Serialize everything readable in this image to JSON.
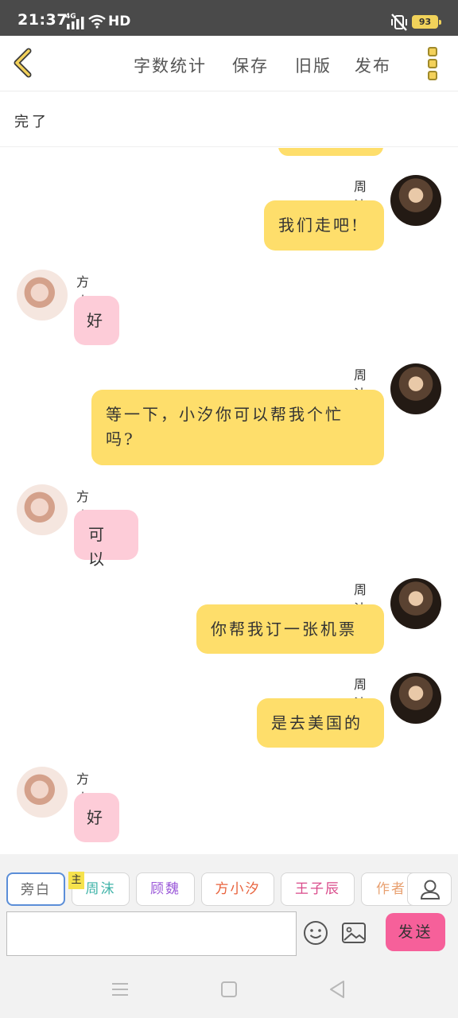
{
  "status_bar": {
    "time": "21:37",
    "network": "4G",
    "hd": "HD",
    "battery": "93",
    "icons": [
      "signal-icon",
      "wifi-icon",
      "vibrate-off-icon",
      "battery-icon"
    ]
  },
  "toolbar": {
    "back_icon": "chevron-left-icon",
    "word_count": "字数统计",
    "save": "保存",
    "old_version": "旧版",
    "publish": "发布",
    "menu_icon": "menu-dots-icon"
  },
  "chapter_title": "完了",
  "messages": [
    {
      "side": "right",
      "sender": "周沫",
      "text": "我们走吧!"
    },
    {
      "side": "left",
      "sender": "方小汐",
      "text": "好"
    },
    {
      "side": "right",
      "sender": "周沫",
      "text": "等一下，小汐你可以帮我个忙吗?"
    },
    {
      "side": "left",
      "sender": "方小汐",
      "text": "可以"
    },
    {
      "side": "right",
      "sender": "周沫",
      "text": "你帮我订一张机票"
    },
    {
      "side": "right",
      "sender": "周沫",
      "text": "是去美国的"
    },
    {
      "side": "left",
      "sender": "方小汐",
      "text": "好"
    }
  ],
  "roles": {
    "main_tag": "主",
    "items": [
      {
        "label": "旁白",
        "color": "#666666"
      },
      {
        "label": "周沫",
        "color": "#3fb3a8"
      },
      {
        "label": "顾魏",
        "color": "#9b59d9"
      },
      {
        "label": "方小汐",
        "color": "#e8623c"
      },
      {
        "label": "王子辰",
        "color": "#d94a8a"
      },
      {
        "label": "作者",
        "color": "#e8a070"
      }
    ],
    "person_icon": "person-icon"
  },
  "input": {
    "placeholder": "",
    "emoji_icon": "emoji-icon",
    "image_icon": "image-icon",
    "send_label": "发送",
    "send_color": "#f6609a"
  },
  "nav": [
    "menu-icon",
    "home-icon",
    "back-triangle-icon"
  ],
  "colors": {
    "self_bubble": "#fede6b",
    "other_bubble": "#fdccd8",
    "accent": "#f3d15a"
  }
}
